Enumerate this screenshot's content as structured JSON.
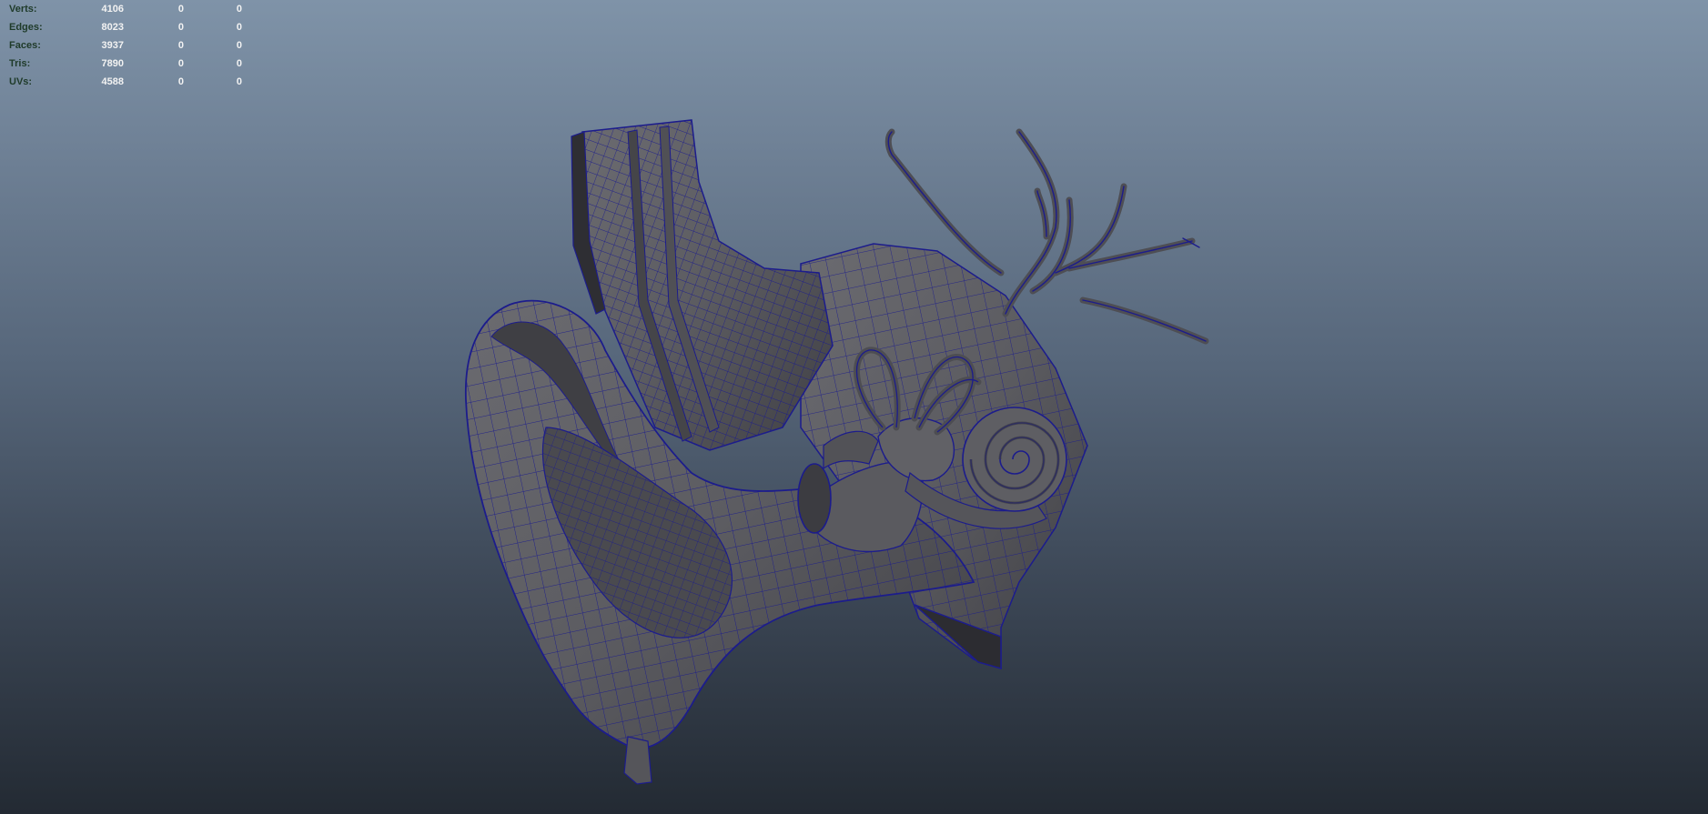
{
  "hud": {
    "rows": [
      {
        "label": "Verts:",
        "v1": "4106",
        "v2": "0",
        "v3": "0"
      },
      {
        "label": "Edges:",
        "v1": "8023",
        "v2": "0",
        "v3": "0"
      },
      {
        "label": "Faces:",
        "v1": "3937",
        "v2": "0",
        "v3": "0"
      },
      {
        "label": "Tris:",
        "v1": "7890",
        "v2": "0",
        "v3": "0"
      },
      {
        "label": "UVs:",
        "v1": "4588",
        "v2": "0",
        "v3": "0"
      }
    ]
  },
  "colors": {
    "background_top": "#7f93a8",
    "background_bottom": "#232a33",
    "mesh_fill": "#5e5e62",
    "wireframe": "#1c1c8c",
    "hud_label": "#1f3b2a",
    "hud_value": "#f2f2f2"
  }
}
